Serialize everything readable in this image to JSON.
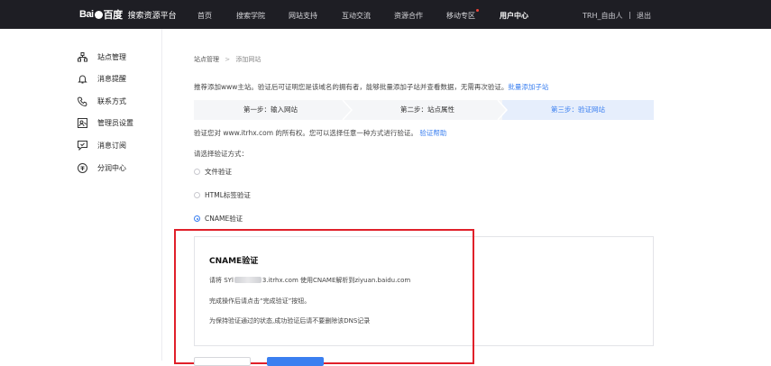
{
  "topbar": {
    "logo_text": "Bai",
    "logo_text_2": "百度",
    "platform_name": "搜索资源平台",
    "nav": [
      {
        "label": "首页"
      },
      {
        "label": "搜索学院"
      },
      {
        "label": "网站支持"
      },
      {
        "label": "互动交流"
      },
      {
        "label": "资源合作"
      },
      {
        "label": "移动专区"
      },
      {
        "label": "用户中心"
      }
    ],
    "user_name": "TRH_自由人",
    "divider": "|",
    "logout": "退出"
  },
  "sidebar": {
    "items": [
      {
        "label": "站点管理",
        "icon": "sitemap-icon"
      },
      {
        "label": "消息提醒",
        "icon": "bell-icon"
      },
      {
        "label": "联系方式",
        "icon": "phone-icon"
      },
      {
        "label": "管理员设置",
        "icon": "admin-icon"
      },
      {
        "label": "消息订阅",
        "icon": "subscribe-icon"
      },
      {
        "label": "分润中心",
        "icon": "coin-icon"
      }
    ]
  },
  "breadcrumb": {
    "root": "站点管理",
    "sep": ">",
    "current": "添加网站"
  },
  "intro": {
    "text": "推荐添加www主站。验证后可证明您是该域名的拥有者，能够批量添加子站并查看数据，无需再次验证。",
    "link": "批量添加子站"
  },
  "steps": [
    {
      "label": "第一步：输入网站"
    },
    {
      "label": "第二步：站点属性"
    },
    {
      "label": "第三步：验证网站"
    }
  ],
  "verify": {
    "text": "验证您对 www.itrhx.com 的所有权。您可以选择任意一种方式进行验证。",
    "link": "验证帮助"
  },
  "choose_label": "请选择验证方式：",
  "methods": [
    {
      "label": "文件验证",
      "selected": false
    },
    {
      "label": "HTML标签验证",
      "selected": false
    },
    {
      "label": "CNAME验证",
      "selected": true
    }
  ],
  "cname": {
    "title": "CNAME验证",
    "line1_prefix": "请将 SYl",
    "line1_suffix": "3.itrhx.com 使用CNAME解析到ziyuan.baidu.com",
    "line2": "完成操作后请点击“完成验证”按钮。",
    "line3": "为保持验证通过的状态,成功验证后请不要删除该DNS记录"
  },
  "colors": {
    "topbar_bg": "#1e1e24",
    "accent": "#3a7ff0",
    "highlight_frame": "#e0202a"
  }
}
